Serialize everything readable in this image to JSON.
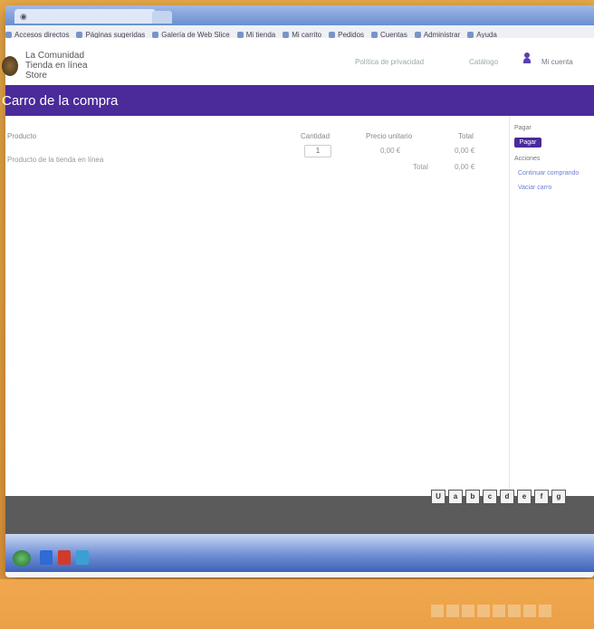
{
  "browser": {
    "bookmarks": [
      "Accesos directos",
      "Páginas sugeridas",
      "Galería de Web Slice",
      "Mi tienda",
      "Mi carrito",
      "Pedidos",
      "Cuentas",
      "Administrar",
      "Ayuda"
    ]
  },
  "header": {
    "store_line1": "La Comunidad",
    "store_line2": "Tienda en línea",
    "store_line3": "Store",
    "link1": "Política de privacidad",
    "link2": "Catálogo",
    "link3": "Mi cuenta"
  },
  "page": {
    "title": "Carro de la compra"
  },
  "cart": {
    "columns": [
      "Producto",
      "Cantidad",
      "Precio unitario",
      "Total"
    ],
    "row": {
      "product": "Producto de la tienda en línea",
      "qty": "1",
      "unit_price": "0,00 €",
      "total": "0,00 €"
    },
    "subtotal_label": "Total",
    "subtotal_value": "0,00 €"
  },
  "sidebar": {
    "pay_label": "Pagar",
    "pay_button": "Pagar",
    "actions_label": "Acciones",
    "link1": "Continuar comprando",
    "link2": "Vaciar carro"
  },
  "pager": {
    "labels": [
      "U",
      "a",
      "b",
      "c",
      "d",
      "e",
      "f",
      "g"
    ]
  },
  "colors": {
    "accent": "#4b2a9a",
    "footer": "#5b5b5b",
    "background": "#eba546"
  }
}
